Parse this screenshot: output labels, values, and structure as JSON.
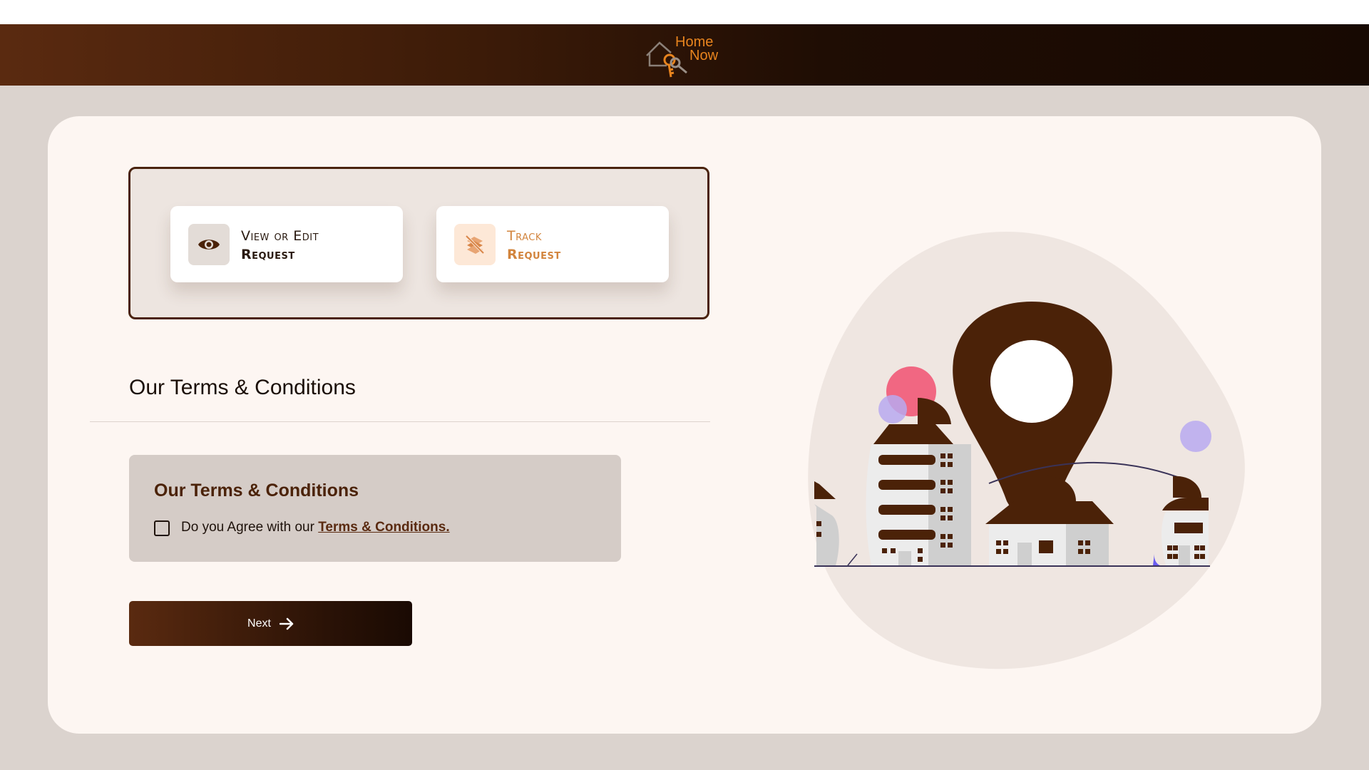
{
  "header": {
    "logo_line1": "Home",
    "logo_line2": "Now"
  },
  "requests": {
    "view": {
      "line1": "View or Edit",
      "line2": "Request",
      "icon": "eye-icon"
    },
    "track": {
      "line1": "Track",
      "line2": "Request",
      "icon": "route-icon"
    }
  },
  "terms": {
    "section_title": "Our Terms & Conditions",
    "box_heading": "Our Terms & Conditions",
    "agree_prefix": "Do you Agree with our ",
    "agree_link": "Terms & Conditions.",
    "checked": false
  },
  "next_button": {
    "label": "Next",
    "icon": "arrow-right-icon"
  },
  "colors": {
    "brand_dark": "#4b2208",
    "accent_orange": "#e8841e",
    "page_bg": "#dbd3ce",
    "card_bg": "#fdf6f2"
  }
}
